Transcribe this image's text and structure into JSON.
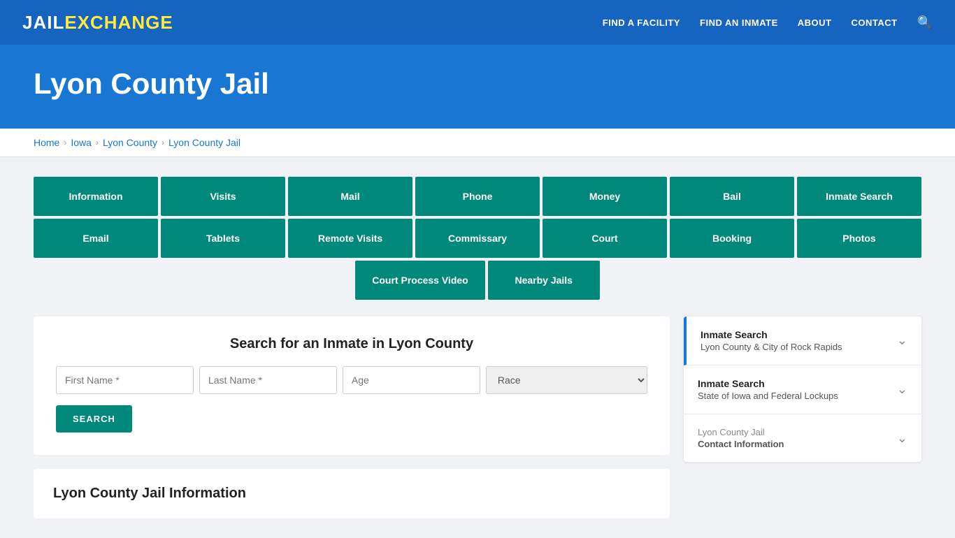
{
  "nav": {
    "logo_jail": "JAIL",
    "logo_exchange": "EXCHANGE",
    "links": [
      {
        "label": "FIND A FACILITY",
        "id": "find-facility"
      },
      {
        "label": "FIND AN INMATE",
        "id": "find-inmate"
      },
      {
        "label": "ABOUT",
        "id": "about"
      },
      {
        "label": "CONTACT",
        "id": "contact"
      }
    ]
  },
  "hero": {
    "title": "Lyon County Jail"
  },
  "breadcrumb": {
    "items": [
      {
        "label": "Home",
        "id": "home"
      },
      {
        "label": "Iowa",
        "id": "iowa"
      },
      {
        "label": "Lyon County",
        "id": "lyon-county"
      },
      {
        "label": "Lyon County Jail",
        "id": "lyon-county-jail"
      }
    ]
  },
  "buttons_row1": [
    "Information",
    "Visits",
    "Mail",
    "Phone",
    "Money",
    "Bail",
    "Inmate Search"
  ],
  "buttons_row2": [
    "Email",
    "Tablets",
    "Remote Visits",
    "Commissary",
    "Court",
    "Booking",
    "Photos"
  ],
  "buttons_row3": [
    "Court Process Video",
    "Nearby Jails"
  ],
  "search": {
    "title": "Search for an Inmate in Lyon County",
    "first_name_placeholder": "First Name *",
    "last_name_placeholder": "Last Name *",
    "age_placeholder": "Age",
    "race_placeholder": "Race",
    "button_label": "SEARCH"
  },
  "info_section": {
    "title": "Lyon County Jail Information"
  },
  "sidebar": {
    "items": [
      {
        "id": "inmate-search-lyon",
        "title": "Inmate Search",
        "subtitle": "Lyon County & City of Rock Rapids",
        "active": true
      },
      {
        "id": "inmate-search-iowa",
        "title": "Inmate Search",
        "subtitle": "State of Iowa and Federal Lockups",
        "active": false
      },
      {
        "id": "contact-info",
        "title": "Lyon County Jail",
        "subtitle": "Contact Information",
        "active": false,
        "inactive": true
      }
    ]
  }
}
